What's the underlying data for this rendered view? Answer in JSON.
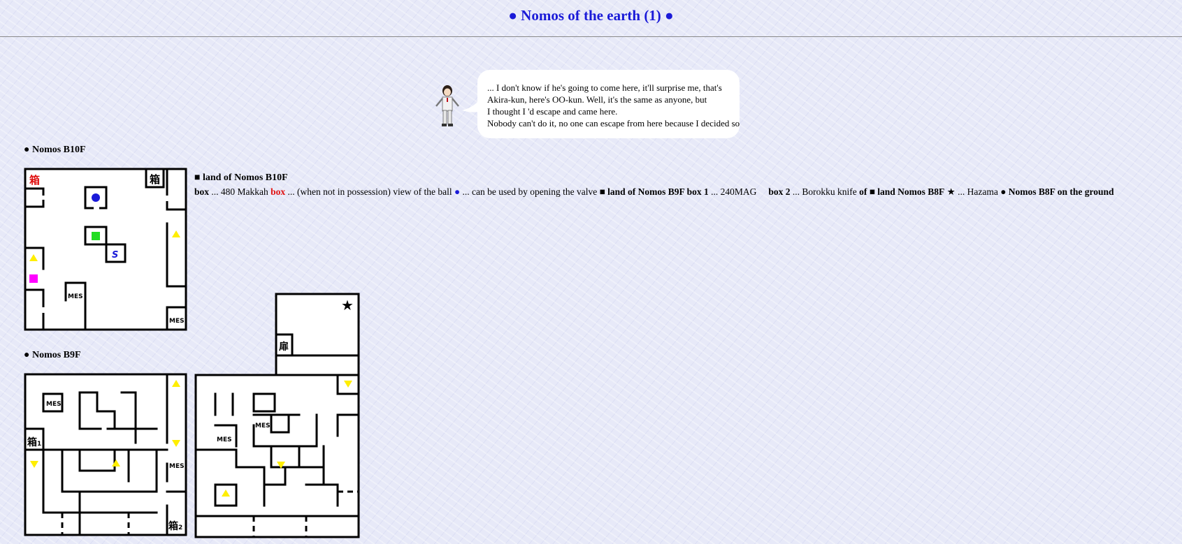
{
  "page": {
    "title": "● Nomos of the earth (1) ●"
  },
  "dialog": {
    "lines": [
      "... I don't know if he's going to come here, it'll surprise me, that's",
      "Akira-kun, here's OO-kun. Well, it's the same as anyone, but",
      "I thought I 'd escape and came here.",
      "Nobody can't do it, no one can escape from here because I decided so"
    ]
  },
  "floors": {
    "b10": {
      "heading": "● Nomos B10F",
      "labels": {
        "box_red": "箱",
        "box": "箱",
        "s": "S",
        "mes1": "MES",
        "mes2": "MES"
      }
    },
    "b9": {
      "heading": "● Nomos B9F",
      "labels": {
        "mes1": "MES",
        "box1": "箱",
        "box1_sub": "1",
        "mes2": "MES",
        "box2": "箱",
        "box2_sub": "2",
        "door": "扉",
        "mes3": "MES",
        "mes4": "MES"
      }
    }
  },
  "legend": {
    "title": "■ land of Nomos B10F",
    "segments": [
      {
        "text": "box",
        "style": "bold"
      },
      {
        "text": " ... 480 Makkah ",
        "style": "normal"
      },
      {
        "text": "box",
        "style": "bold-red"
      },
      {
        "text": " ... (when not in possession) view of the ball ",
        "style": "normal"
      },
      {
        "text": "●",
        "style": "blue"
      },
      {
        "text": " ... can be used by opening the valve ",
        "style": "normal"
      },
      {
        "text": "■ land of Nomos B9F box 1",
        "style": "bold"
      },
      {
        "text": " ... 240MAG     ",
        "style": "normal"
      },
      {
        "text": "box 2",
        "style": "bold"
      },
      {
        "text": " ... Borokku knife ",
        "style": "normal"
      },
      {
        "text": "of ■ land Nomos B8F",
        "style": "bold"
      },
      {
        "text": " ★ ... Hazama ",
        "style": "normal"
      },
      {
        "text": "● Nomos B8F on the ground",
        "style": "bold"
      }
    ]
  },
  "colors": {
    "title": "#1a1ad8",
    "box_red": "#e01010",
    "blue_ball": "#1a1ad8",
    "green_square": "#22dd22",
    "magenta_square": "#ff00ff",
    "yellow_triangle": "#ffee00"
  }
}
